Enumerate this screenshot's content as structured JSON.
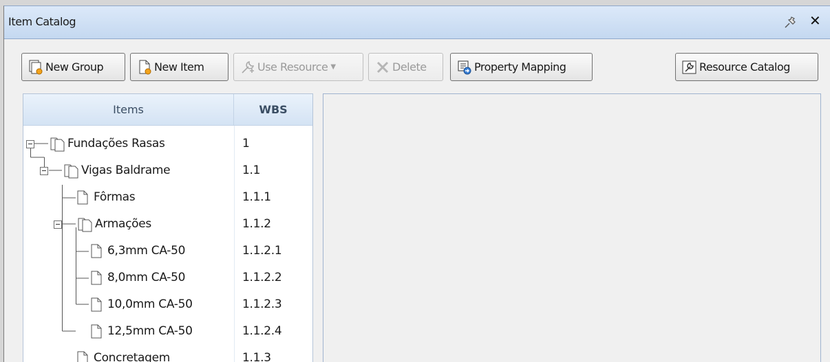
{
  "window": {
    "title": "Item Catalog"
  },
  "toolbar": {
    "new_group": "New Group",
    "new_item": "New Item",
    "use_resource": "Use Resource",
    "delete": "Delete",
    "property_mapping": "Property Mapping",
    "resource_catalog": "Resource Catalog"
  },
  "tree": {
    "columns": {
      "items": "Items",
      "wbs": "WBS"
    },
    "rows": [
      {
        "label": "Fundações Rasas",
        "wbs": "1",
        "type": "group"
      },
      {
        "label": "Vigas Baldrame",
        "wbs": "1.1",
        "type": "group"
      },
      {
        "label": "Fôrmas",
        "wbs": "1.1.1",
        "type": "item"
      },
      {
        "label": "Armações",
        "wbs": "1.1.2",
        "type": "group"
      },
      {
        "label": "6,3mm CA-50",
        "wbs": "1.1.2.1",
        "type": "item"
      },
      {
        "label": "8,0mm CA-50",
        "wbs": "1.1.2.2",
        "type": "item"
      },
      {
        "label": "10,0mm CA-50",
        "wbs": "1.1.2.3",
        "type": "item"
      },
      {
        "label": "12,5mm CA-50",
        "wbs": "1.1.2.4",
        "type": "item"
      },
      {
        "label": "Concretagem",
        "wbs": "1.1.3",
        "type": "item"
      }
    ]
  },
  "colors": {
    "titlebar": "#c4d8f0",
    "pane_border": "#9fb3cf",
    "header": "#d4e3f4"
  }
}
